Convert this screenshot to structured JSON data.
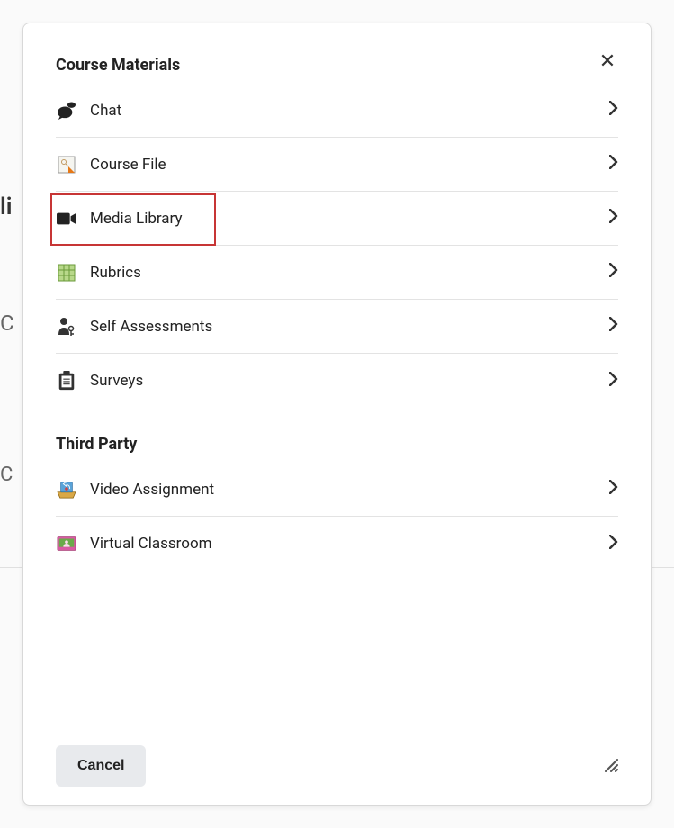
{
  "sections": [
    {
      "title": "Course Materials",
      "items": [
        {
          "label": "Chat",
          "icon": "chat-icon"
        },
        {
          "label": "Course File",
          "icon": "file-icon"
        },
        {
          "label": "Media Library",
          "icon": "video-icon"
        },
        {
          "label": "Rubrics",
          "icon": "grid-icon"
        },
        {
          "label": "Self Assessments",
          "icon": "person-key-icon"
        },
        {
          "label": "Surveys",
          "icon": "clipboard-icon"
        }
      ]
    },
    {
      "title": "Third Party",
      "items": [
        {
          "label": "Video Assignment",
          "icon": "video-assignment-icon"
        },
        {
          "label": "Virtual Classroom",
          "icon": "virtual-classroom-icon"
        }
      ]
    }
  ],
  "footer": {
    "cancel": "Cancel"
  }
}
